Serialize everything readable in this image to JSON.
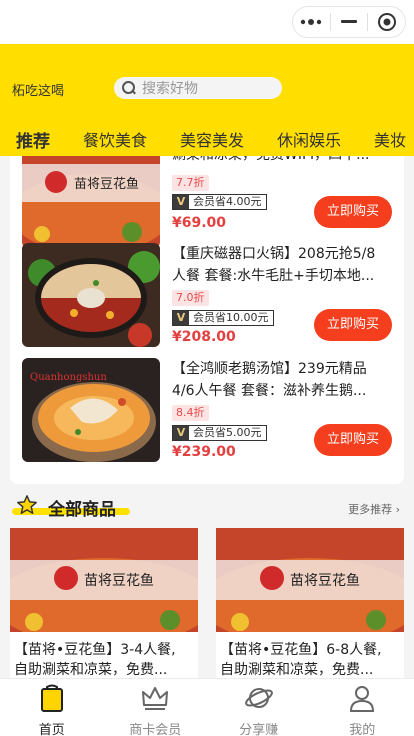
{
  "capsule": {
    "more_icon": "more-dots-icon",
    "minimize_icon": "minus-icon",
    "close_icon": "target-circle-icon"
  },
  "header": {
    "city": "柘吃这喝",
    "search_placeholder": "搜索好物",
    "categories": [
      "推荐",
      "餐饮美食",
      "美容美发",
      "休闲娱乐",
      "美妆"
    ]
  },
  "recommend": [
    {
      "title_lines": [
        "涮菜和凉菜，免费WIFI，四十..."
      ],
      "discount": "7.7折",
      "vip_text": "会员省4.00元",
      "price": "¥69.00",
      "buy_label": "立即购买",
      "sign_text": "苗将豆花鱼"
    },
    {
      "title_lines": [
        "【重庆磁器口火锅】208元抢5/8",
        "人餐 套餐:水牛毛肚+手切本地..."
      ],
      "discount": "7.0折",
      "vip_text": "会员省10.00元",
      "price": "¥208.00",
      "buy_label": "立即购买"
    },
    {
      "title_lines": [
        "【全鸿顺老鹅汤馆】239元精品",
        "4/6人午餐 套餐：滋补养生鹅..."
      ],
      "discount": "8.4折",
      "vip_text": "会员省5.00元",
      "price": "¥239.00",
      "buy_label": "立即购买"
    }
  ],
  "vip_badge": "V",
  "all_goods": {
    "title": "全部商品",
    "more": "更多推荐",
    "items": [
      {
        "title_lines": [
          "【苗将•豆花鱼】3-4人餐,",
          "自助涮菜和凉菜，免费..."
        ],
        "sign_text": "苗将豆花鱼"
      },
      {
        "title_lines": [
          "【苗将•豆花鱼】6-8人餐,",
          "自助涮菜和凉菜，免费..."
        ],
        "sign_text": "苗将豆花鱼"
      }
    ]
  },
  "tabbar": [
    {
      "label": "首页",
      "icon": "shopping-bag-icon",
      "active": true
    },
    {
      "label": "商卡会员",
      "icon": "crown-icon",
      "active": false
    },
    {
      "label": "分享赚",
      "icon": "planet-icon",
      "active": false
    },
    {
      "label": "我的",
      "icon": "user-icon",
      "active": false
    }
  ],
  "colors": {
    "brand_yellow": "#ffde00",
    "buy_red": "#f43e1e",
    "price_red": "#e44040"
  }
}
